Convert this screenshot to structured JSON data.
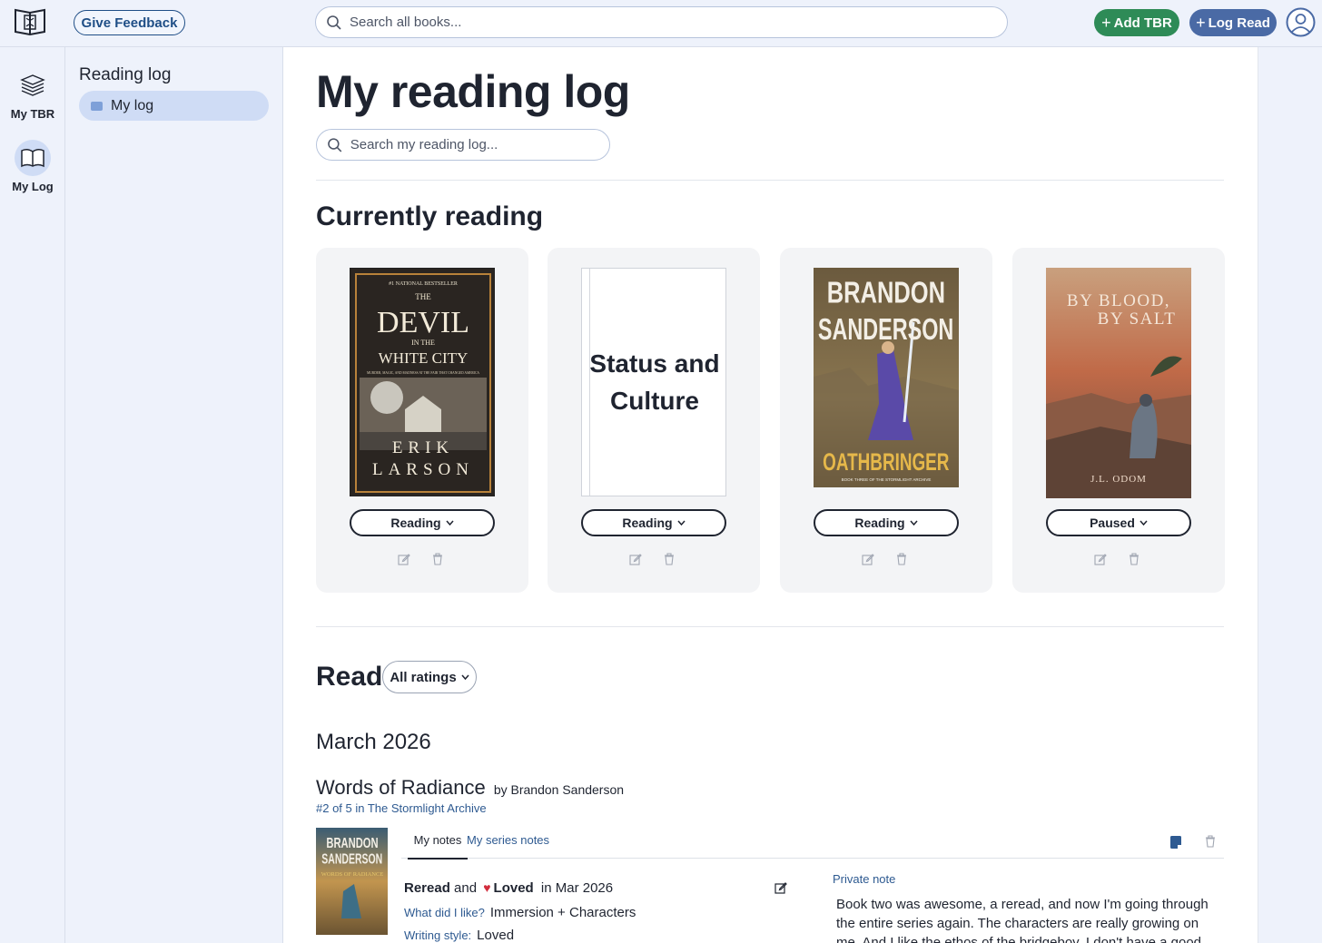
{
  "header": {
    "feedback_label": "Give Feedback",
    "search_placeholder": "Search all books...",
    "add_tbr_label": "Add TBR",
    "log_read_label": "Log Read"
  },
  "rail": {
    "tbr_label": "My TBR",
    "log_label": "My Log"
  },
  "sidebar": {
    "title": "Reading log",
    "items": [
      {
        "label": "My log"
      }
    ]
  },
  "main": {
    "title": "My reading log",
    "search_placeholder": "Search my reading log...",
    "currently_reading_title": "Currently reading",
    "current_books": [
      {
        "cover_lines": [
          "#1 NATIONAL BESTSELLER",
          "THE",
          "DEVIL",
          "IN THE",
          "WHITE CITY",
          "MURDER, MAGIC, AND MADNESS AT THE FAIR THAT CHANGED AMERICA",
          "ERIK",
          "LARSON"
        ],
        "status": "Reading"
      },
      {
        "cover_lines": [
          "Status and",
          "Culture"
        ],
        "status": "Reading"
      },
      {
        "cover_lines": [
          "BRANDON",
          "SANDERSON",
          "OATHBRINGER",
          "BOOK THREE OF THE STORMLIGHT ARCHIVE"
        ],
        "status": "Reading"
      },
      {
        "cover_lines": [
          "BY BLOOD,",
          "BY SALT",
          "J.L. ODOM"
        ],
        "status": "Paused"
      }
    ],
    "read_title": "Read",
    "ratings_filter": "All ratings",
    "month": "March 2026",
    "entry": {
      "title": "Words of Radiance",
      "by": "by Brandon Sanderson",
      "series": "#2 of 5 in The Stormlight Archive",
      "cover_lines": [
        "BRANDON",
        "SANDERSON",
        "WORDS OF RADIANCE"
      ],
      "tab_notes": "My notes",
      "tab_series_notes": "My series notes",
      "status_word": "Reread",
      "and_word": "and",
      "loved_word": "Loved",
      "date_text": "in Mar 2026",
      "liked_label": "What did I like?",
      "liked_value": "Immersion + Characters",
      "style_label": "Writing style:",
      "style_value": "Loved",
      "private_label": "Private note",
      "private_note": "Book two was awesome, a reread, and now I'm going through the entire series again. The characters are really growing on me. And I like the ethos of the bridgeboy. I don't have a good picture"
    }
  },
  "colors": {
    "accent_green": "#2e8b57",
    "accent_blue": "#4a6aa5",
    "link_blue": "#2e5a91",
    "heart_red": "#d22d3d"
  }
}
